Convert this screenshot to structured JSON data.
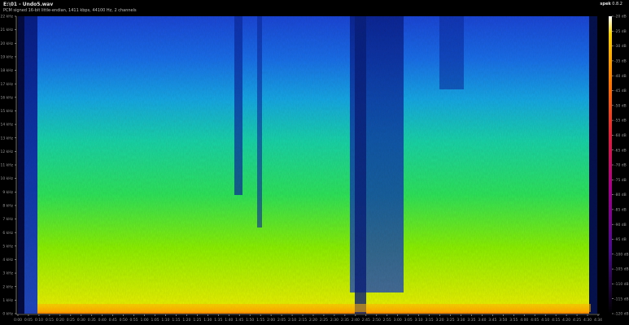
{
  "header": {
    "file_title": "E:\\01 - Undo5.wav",
    "format_info": "PCM signed 16-bit little-endian, 1411 kbps, 44100 Hz, 2 channels",
    "app_name": "spek",
    "app_version": "0.8.2"
  },
  "frequency_axis": {
    "labels": [
      "0 kHz",
      "1 kHz",
      "2 kHz",
      "3 kHz",
      "4 kHz",
      "5 kHz",
      "6 kHz",
      "7 kHz",
      "8 kHz",
      "9 kHz",
      "10 kHz",
      "11 kHz",
      "12 kHz",
      "13 kHz",
      "14 kHz",
      "15 kHz",
      "16 kHz",
      "17 kHz",
      "18 kHz",
      "19 kHz",
      "20 kHz",
      "21 kHz",
      "22 kHz"
    ]
  },
  "time_axis": {
    "labels": [
      "0:00",
      "0:05",
      "0:10",
      "0:15",
      "0:20",
      "0:25",
      "0:30",
      "0:35",
      "0:40",
      "0:45",
      "0:50",
      "0:55",
      "1:00",
      "1:05",
      "1:10",
      "1:15",
      "1:20",
      "1:25",
      "1:30",
      "1:35",
      "1:40",
      "1:45",
      "1:50",
      "1:55",
      "2:00",
      "2:05",
      "2:10",
      "2:15",
      "2:20",
      "2:25",
      "2:30",
      "2:35",
      "2:40",
      "2:45",
      "2:50",
      "2:55",
      "3:00",
      "3:05",
      "3:10",
      "3:15",
      "3:20",
      "3:25",
      "3:30",
      "3:35",
      "3:40",
      "3:45",
      "3:50",
      "3:55",
      "4:00",
      "4:05",
      "4:10",
      "4:15",
      "4:20",
      "4:25",
      "4:30",
      "4:34"
    ]
  },
  "db_scale": {
    "labels": [
      "-20 dB",
      "-25 dB",
      "-30 dB",
      "-35 dB",
      "-40 dB",
      "-45 dB",
      "-50 dB",
      "-55 dB",
      "-60 dB",
      "-65 dB",
      "-70 dB",
      "-75 dB",
      "-80 dB",
      "-85 dB",
      "-90 dB",
      "-95 dB",
      "-100 dB",
      "-105 dB",
      "-110 dB",
      "-115 dB",
      "-120 dB"
    ]
  }
}
